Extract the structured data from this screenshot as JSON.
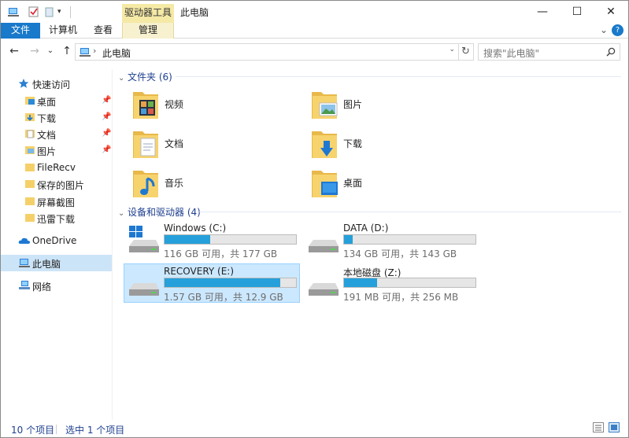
{
  "window": {
    "title": "此电脑",
    "tool_tab": "驱动器工具"
  },
  "caption": {
    "minimize": "—",
    "maximize": "☐",
    "close": "✕"
  },
  "ribbon": {
    "tabs": [
      {
        "label": "文件"
      },
      {
        "label": "计算机"
      },
      {
        "label": "查看"
      },
      {
        "label": "管理"
      }
    ],
    "expand": "⌄",
    "help": "?"
  },
  "address": {
    "back": "←",
    "forward": "→",
    "recent": "⌄",
    "up": "↑",
    "chevron": "›",
    "path": "此电脑",
    "dropdown": "⌄",
    "refresh": "↻"
  },
  "search": {
    "placeholder": "搜索\"此电脑\""
  },
  "sidebar": {
    "quick_access": "快速访问",
    "items": [
      {
        "label": "桌面",
        "pinned": true
      },
      {
        "label": "下载",
        "pinned": true
      },
      {
        "label": "文档",
        "pinned": true
      },
      {
        "label": "图片",
        "pinned": true
      },
      {
        "label": "FileRecv",
        "pinned": false
      },
      {
        "label": "保存的图片",
        "pinned": false
      },
      {
        "label": "屏幕截图",
        "pinned": false
      },
      {
        "label": "迅雷下载",
        "pinned": false
      }
    ],
    "onedrive": "OneDrive",
    "this_pc": "此电脑",
    "network": "网络"
  },
  "folders_group": {
    "label": "文件夹 (6)"
  },
  "folders": [
    {
      "label": "视频"
    },
    {
      "label": "图片"
    },
    {
      "label": "文档"
    },
    {
      "label": "下载"
    },
    {
      "label": "音乐"
    },
    {
      "label": "桌面"
    }
  ],
  "drives_group": {
    "label": "设备和驱动器 (4)"
  },
  "drives": [
    {
      "name": "Windows (C:)",
      "size": "116 GB 可用，共 177 GB",
      "used_fraction": 0.345
    },
    {
      "name": "DATA (D:)",
      "size": "134 GB 可用，共 143 GB",
      "used_fraction": 0.063
    },
    {
      "name": "RECOVERY (E:)",
      "size": "1.57 GB 可用，共 12.9 GB",
      "used_fraction": 0.878
    },
    {
      "name": "本地磁盘 (Z:)",
      "size": "191 MB 可用，共 256 MB",
      "used_fraction": 0.254
    }
  ],
  "status": {
    "item_count": "10 个项目",
    "selected": "选中 1 个项目"
  },
  "colors": {
    "accent": "#1979ca",
    "selection": "#cce8ff",
    "bar_fill": "#26a0da",
    "folder": "#f5d06a"
  }
}
